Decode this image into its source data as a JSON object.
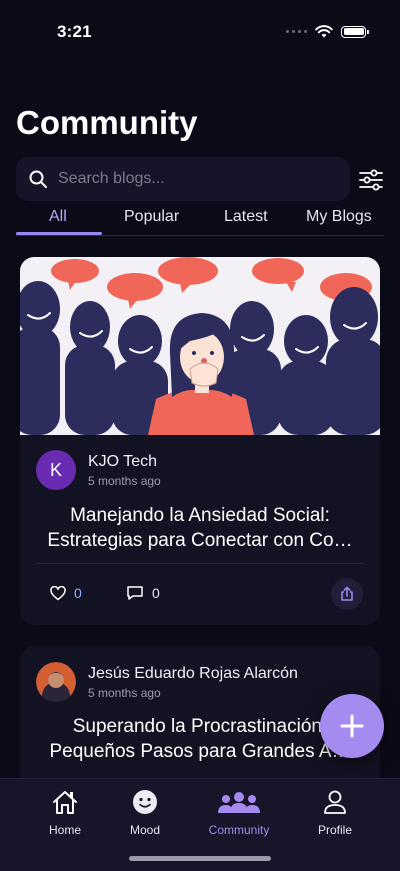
{
  "status_bar": {
    "time": "3:21"
  },
  "page": {
    "title": "Community"
  },
  "search": {
    "placeholder": "Search blogs..."
  },
  "tabs": [
    {
      "label": "All",
      "active": true
    },
    {
      "label": "Popular",
      "active": false
    },
    {
      "label": "Latest",
      "active": false
    },
    {
      "label": "My Blogs",
      "active": false
    }
  ],
  "posts": [
    {
      "author": "KJO Tech",
      "avatar_initial": "K",
      "time": "5 months ago",
      "title": "Manejando la Ansiedad Social:\nEstrategias para Conectar con Co…",
      "likes": "0",
      "comments": "0"
    },
    {
      "author": "Jesús Eduardo Rojas Alarcón",
      "time": "5 months ago",
      "title": "Superando la Procrastinación:\nPequeños Pasos para Grandes A…"
    }
  ],
  "bottom_nav": [
    {
      "label": "Home",
      "icon": "home-icon",
      "active": false
    },
    {
      "label": "Mood",
      "icon": "smiley-icon",
      "active": false
    },
    {
      "label": "Community",
      "icon": "people-icon",
      "active": true
    },
    {
      "label": "Profile",
      "icon": "profile-icon",
      "active": false
    }
  ],
  "colors": {
    "background": "#0b0a17",
    "card": "#131222",
    "accent": "#a58af0",
    "avatar": "#6a2bb3",
    "like_count": "#8bb1ff"
  }
}
